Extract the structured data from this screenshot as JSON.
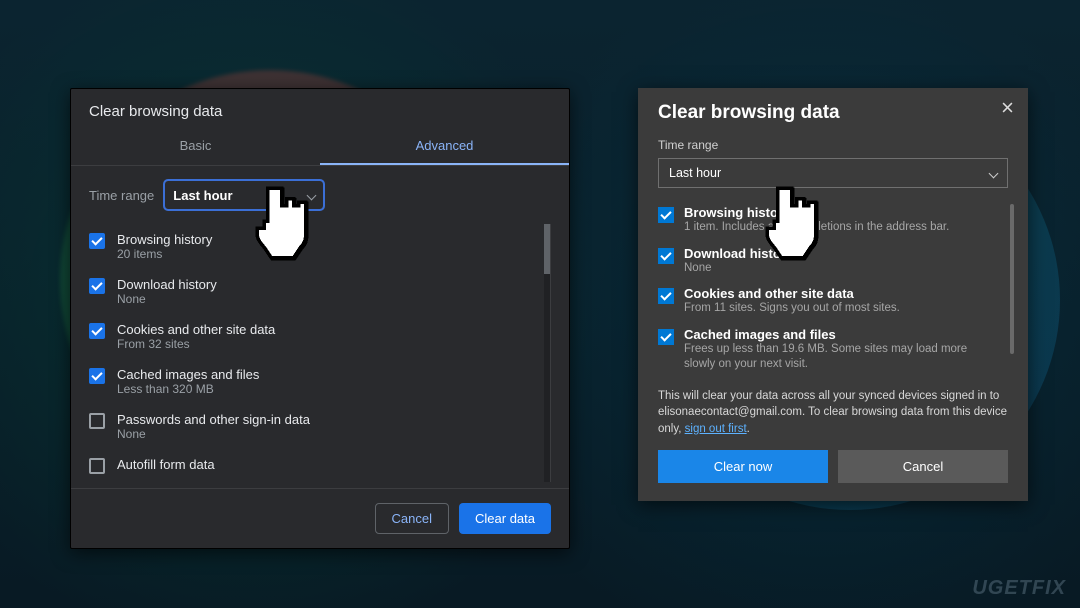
{
  "chrome": {
    "title": "Clear browsing data",
    "tabs": {
      "basic": "Basic",
      "advanced": "Advanced"
    },
    "time_range_label": "Time range",
    "time_range_value": "Last hour",
    "items": [
      {
        "label": "Browsing history",
        "sub": "20 items",
        "checked": true
      },
      {
        "label": "Download history",
        "sub": "None",
        "checked": true
      },
      {
        "label": "Cookies and other site data",
        "sub": "From 32 sites",
        "checked": true
      },
      {
        "label": "Cached images and files",
        "sub": "Less than 320 MB",
        "checked": true
      },
      {
        "label": "Passwords and other sign-in data",
        "sub": "None",
        "checked": false
      },
      {
        "label": "Autofill form data",
        "sub": "",
        "checked": false
      }
    ],
    "cancel": "Cancel",
    "confirm": "Clear data"
  },
  "edge": {
    "title": "Clear browsing data",
    "time_range_label": "Time range",
    "time_range_value": "Last hour",
    "items": [
      {
        "label": "Browsing history",
        "sub": "1 item. Includes autocompletions in the address bar.",
        "checked": true
      },
      {
        "label": "Download history",
        "sub": "None",
        "checked": true
      },
      {
        "label": "Cookies and other site data",
        "sub": "From 11 sites. Signs you out of most sites.",
        "checked": true
      },
      {
        "label": "Cached images and files",
        "sub": "Frees up less than 19.6 MB. Some sites may load more slowly on your next visit.",
        "checked": true
      }
    ],
    "note_a": "This will clear your data across all your synced devices signed in to elisonaecontact@gmail.com. To clear browsing data from this device only, ",
    "note_link": "sign out first",
    "note_b": ".",
    "confirm": "Clear now",
    "cancel": "Cancel"
  },
  "watermark": "UGETFIX"
}
